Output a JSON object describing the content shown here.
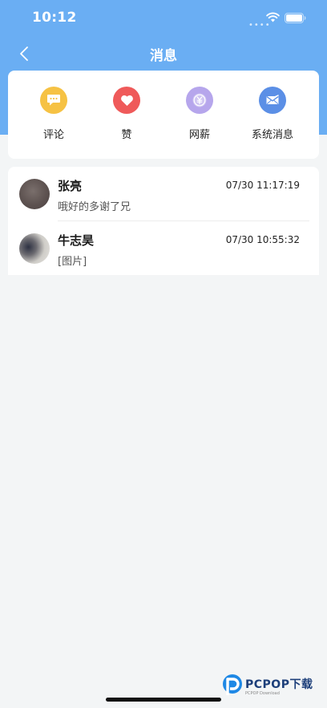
{
  "status_bar": {
    "time": "10:12",
    "signal_dots": "••••"
  },
  "nav": {
    "title": "消息",
    "back_icon": "chevron-left-icon"
  },
  "categories": [
    {
      "label": "评论",
      "icon": "comment-icon",
      "color": "#f6c244"
    },
    {
      "label": "赞",
      "icon": "heart-icon",
      "color": "#ef5a5a"
    },
    {
      "label": "网薪",
      "icon": "yen-coin-icon",
      "color": "#b6a6ec"
    },
    {
      "label": "系统消息",
      "icon": "mail-icon",
      "color": "#5b8fe6"
    }
  ],
  "messages": [
    {
      "name": "张亮",
      "time": "07/30 11:17:19",
      "preview": "哦好的多谢了兄"
    },
    {
      "name": "牛志昊",
      "time": "07/30 10:55:32",
      "preview": "[图片]"
    }
  ],
  "watermark": {
    "brand": "PCPOP下载",
    "sub": "PCPOP Download"
  },
  "colors": {
    "header": "#6aaef3",
    "background": "#f3f5f6"
  }
}
